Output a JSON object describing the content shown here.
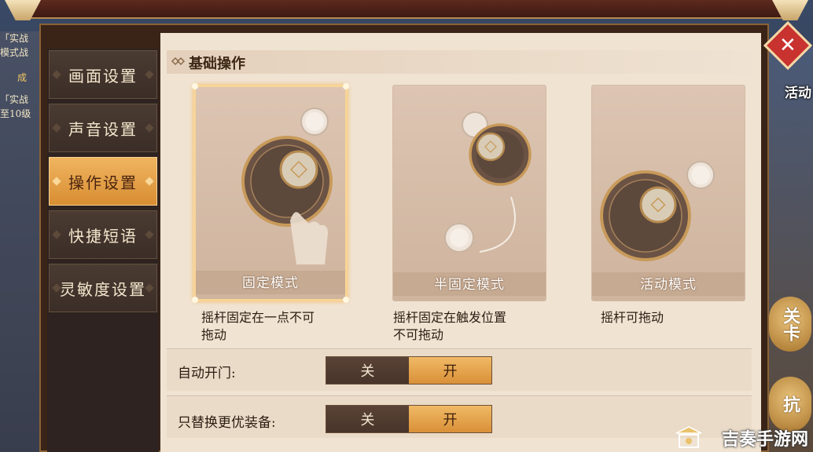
{
  "background": {
    "left_texts": [
      "「实战",
      "模式战",
      "成",
      "「实战",
      "至10级"
    ],
    "activity_label": "活动",
    "side_buttons": [
      "关卡",
      "抗"
    ]
  },
  "sidebar": {
    "items": [
      {
        "label": "画面设置",
        "active": false
      },
      {
        "label": "声音设置",
        "active": false
      },
      {
        "label": "操作设置",
        "active": true
      },
      {
        "label": "快捷短语",
        "active": false
      },
      {
        "label": "灵敏度设置",
        "active": false
      }
    ]
  },
  "section": {
    "title": "基础操作"
  },
  "modes": [
    {
      "label": "固定模式",
      "desc_line1": "摇杆固定在一点不可",
      "desc_line2": "拖动",
      "selected": true
    },
    {
      "label": "半固定模式",
      "desc_line1": "摇杆固定在触发位置",
      "desc_line2": "不可拖动",
      "selected": false
    },
    {
      "label": "活动模式",
      "desc_line1": "摇杆可拖动",
      "desc_line2": "",
      "selected": false
    }
  ],
  "settings": [
    {
      "label": "自动开门:",
      "off_label": "关",
      "on_label": "开",
      "value": "开"
    },
    {
      "label": "只替换更优装备:",
      "off_label": "关",
      "on_label": "开",
      "value": "开"
    }
  ],
  "watermark": "吉奏手游网",
  "colors": {
    "accent": "#e3a04a",
    "panel": "#f0e3d2",
    "close": "#c8332f"
  }
}
